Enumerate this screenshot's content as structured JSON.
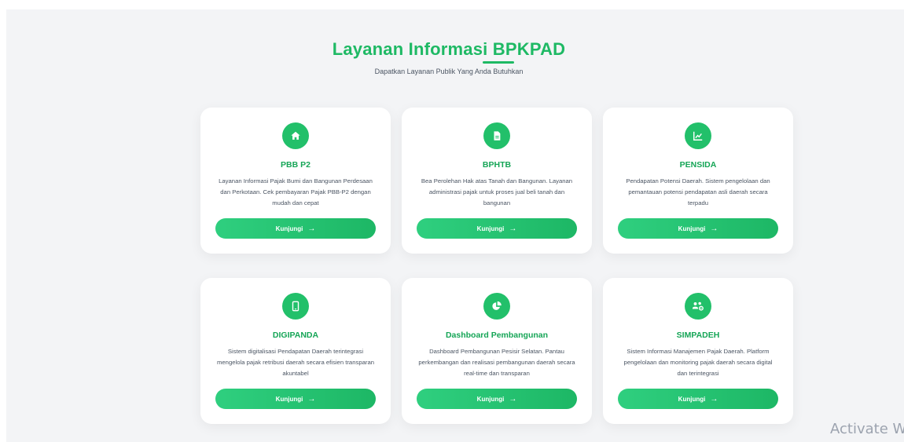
{
  "header": {
    "title": "Layanan Informasi BPKPAD",
    "subtitle": "Dapatkan Layanan Publik Yang Anda Butuhkan"
  },
  "cards": [
    {
      "title": "PBB P2",
      "description": "Layanan Informasi Pajak Bumi dan Bangunan Perdesaan dan Perkotaan. Cek pembayaran Pajak PBB-P2 dengan mudah dan cepat",
      "button": "Kunjungi",
      "icon": "home-icon"
    },
    {
      "title": "BPHTB",
      "description": "Bea Perolehan Hak atas Tanah dan Bangunan. Layanan administrasi pajak untuk proses jual beli tanah dan bangunan",
      "button": "Kunjungi",
      "icon": "document-icon"
    },
    {
      "title": "PENSIDA",
      "description": "Pendapatan Potensi Daerah. Sistem pengelolaan dan pemantauan potensi pendapatan asli daerah secara terpadu",
      "button": "Kunjungi",
      "icon": "chart-line-icon"
    },
    {
      "title": "DIGIPANDA",
      "description": "Sistem digitalisasi Pendapatan Daerah terintegrasi mengelola pajak retribusi daerah secara efisien transparan akuntabel",
      "button": "Kunjungi",
      "icon": "mobile-icon"
    },
    {
      "title": "Dashboard Pembangunan",
      "description": "Dashboard Pembangunan Pesisir Selatan. Pantau perkembangan dan realisasi pembangunan daerah secara real-time dan transparan",
      "button": "Kunjungi",
      "icon": "pie-chart-icon"
    },
    {
      "title": "SIMPADEH",
      "description": "Sistem Informasi Manajemen Pajak Daerah. Platform pengelolaan dan monitoring pajak daerah secara digital dan terintegrasi",
      "button": "Kunjungi",
      "icon": "users-cog-icon"
    }
  ],
  "watermark": "Activate W",
  "colors": {
    "accent": "#1eb964",
    "button_start": "#2fcf7f",
    "button_end": "#1db765"
  }
}
